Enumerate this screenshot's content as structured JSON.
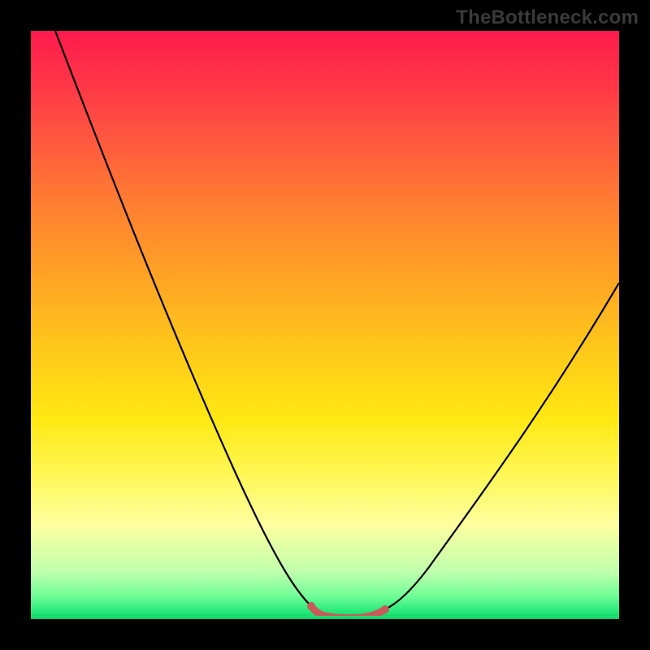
{
  "watermark": "TheBottleneck.com",
  "colors": {
    "frame": "#000000",
    "gradient_top": "#ff1a4d",
    "gradient_bottom": "#0ec760",
    "curve": "#000000",
    "highlight_segment": "#c85a5a"
  },
  "chart_data": {
    "type": "line",
    "title": "",
    "xlabel": "",
    "ylabel": "",
    "xlim": [
      0,
      100
    ],
    "ylim": [
      0,
      100
    ],
    "series": [
      {
        "name": "bottleneck-curve",
        "x": [
          4,
          10,
          15,
          20,
          25,
          30,
          35,
          40,
          45,
          48,
          50,
          53,
          55,
          58,
          60,
          65,
          70,
          75,
          80,
          85,
          90,
          95,
          100
        ],
        "values": [
          100,
          90,
          80,
          70,
          60,
          49,
          38,
          26,
          12,
          4,
          1,
          0,
          0,
          0,
          1,
          4,
          11,
          19,
          27,
          35,
          43,
          50,
          57
        ]
      }
    ],
    "highlight_range_x": [
      48,
      60
    ],
    "annotations": []
  }
}
